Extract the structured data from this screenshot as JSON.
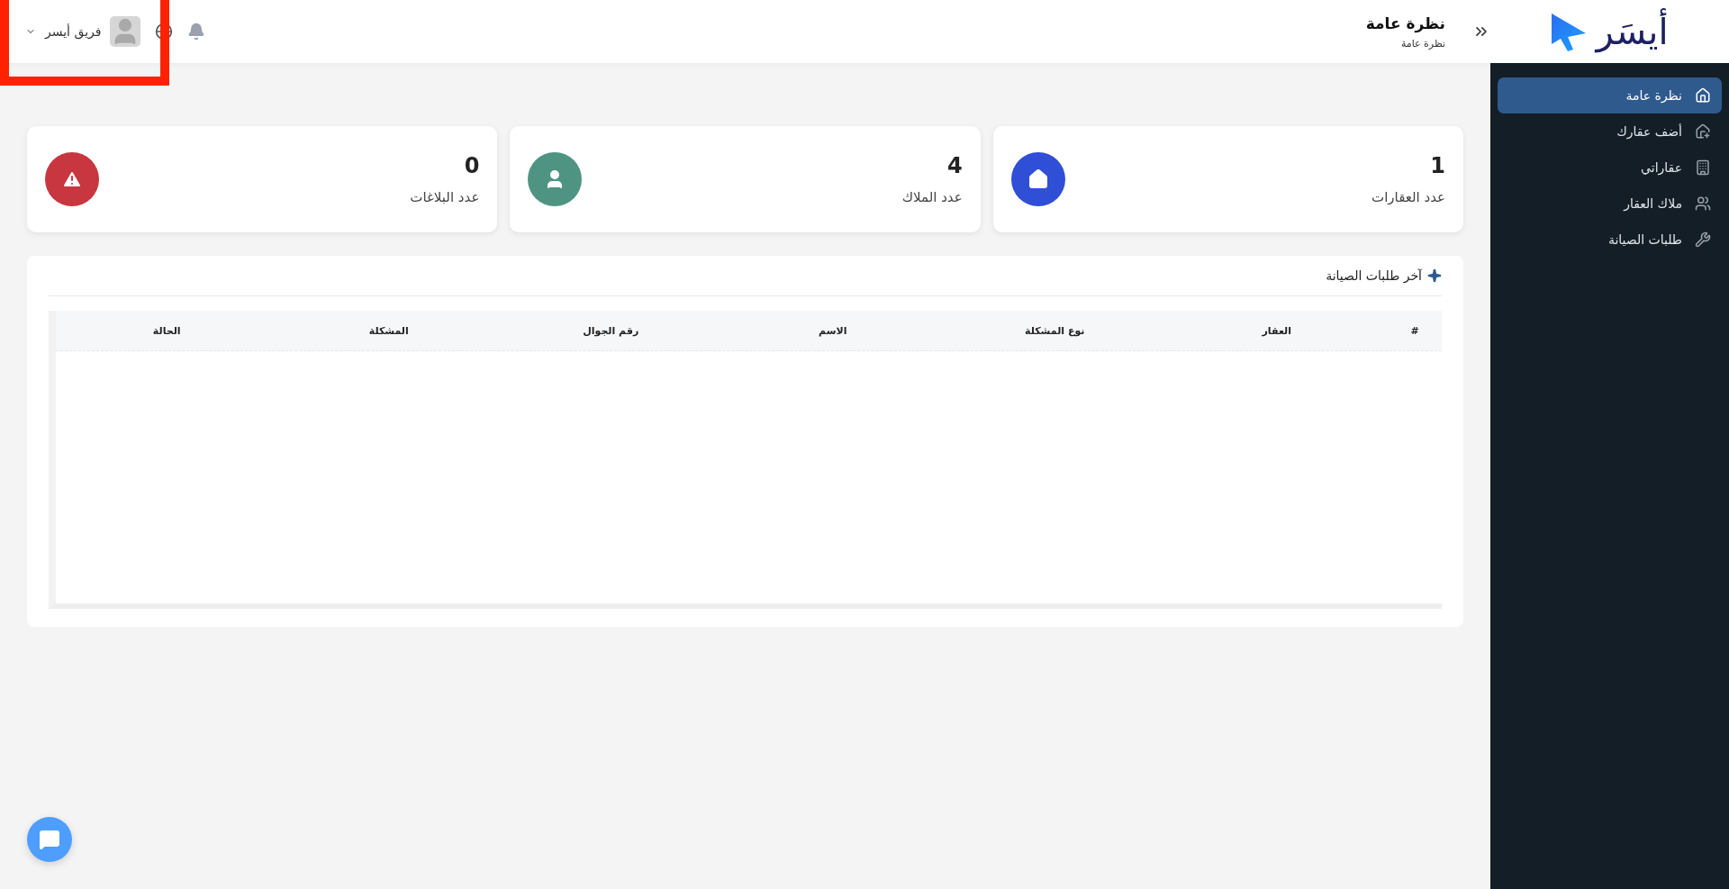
{
  "logo": {
    "text": "أيسَر"
  },
  "header": {
    "title": "نظرة عامة",
    "breadcrumb": "نظرة عامة",
    "user_name": "فريق أيسر"
  },
  "sidebar": {
    "items": [
      {
        "label": "نظرة عامة",
        "selected": true
      },
      {
        "label": "أضف عقارك",
        "selected": false
      },
      {
        "label": "عقاراتي",
        "selected": false
      },
      {
        "label": "ملاك العقار",
        "selected": false
      },
      {
        "label": "طلبات الصيانة",
        "selected": false
      }
    ]
  },
  "stats": [
    {
      "value": "1",
      "label": "عدد العقارات",
      "color": "#2f4fd6"
    },
    {
      "value": "4",
      "label": "عدد الملاك",
      "color": "#4f9482"
    },
    {
      "value": "0",
      "label": "عدد البلاغات",
      "color": "#c8363f"
    }
  ],
  "maintenance": {
    "title": "آخر طلبات الصيانة",
    "table": {
      "columns": [
        "#",
        "العقار",
        "نوع المشكلة",
        "الاسم",
        "رقم الجوال",
        "المشكلة",
        "الحالة"
      ]
    }
  }
}
